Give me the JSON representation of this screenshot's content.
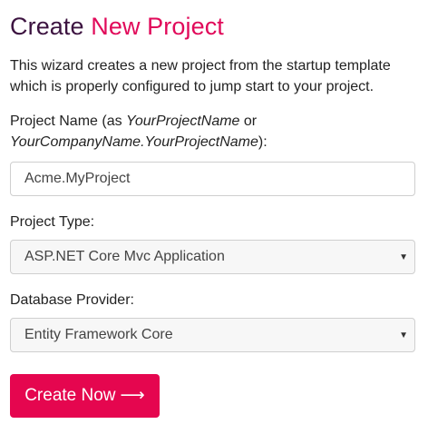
{
  "header": {
    "title_part1": "Create",
    "title_part2": "New Project",
    "description": "This wizard creates a new project from the startup template which is properly configured to jump start to your project."
  },
  "form": {
    "project_name": {
      "label_prefix": "Project Name (as ",
      "label_em1": "YourProjectName",
      "label_mid": " or ",
      "label_em2": "YourCompanyName.YourProjectName",
      "label_suffix": "):",
      "value": "Acme.MyProject"
    },
    "project_type": {
      "label": "Project Type:",
      "selected": "ASP.NET Core Mvc Application"
    },
    "database_provider": {
      "label": "Database Provider:",
      "selected": "Entity Framework Core"
    },
    "submit": {
      "label": "Create Now",
      "icon": "arrow-right-icon"
    }
  },
  "colors": {
    "title_dark": "#3c1340",
    "title_accent": "#e10a5a",
    "button_bg": "#e5064f"
  }
}
